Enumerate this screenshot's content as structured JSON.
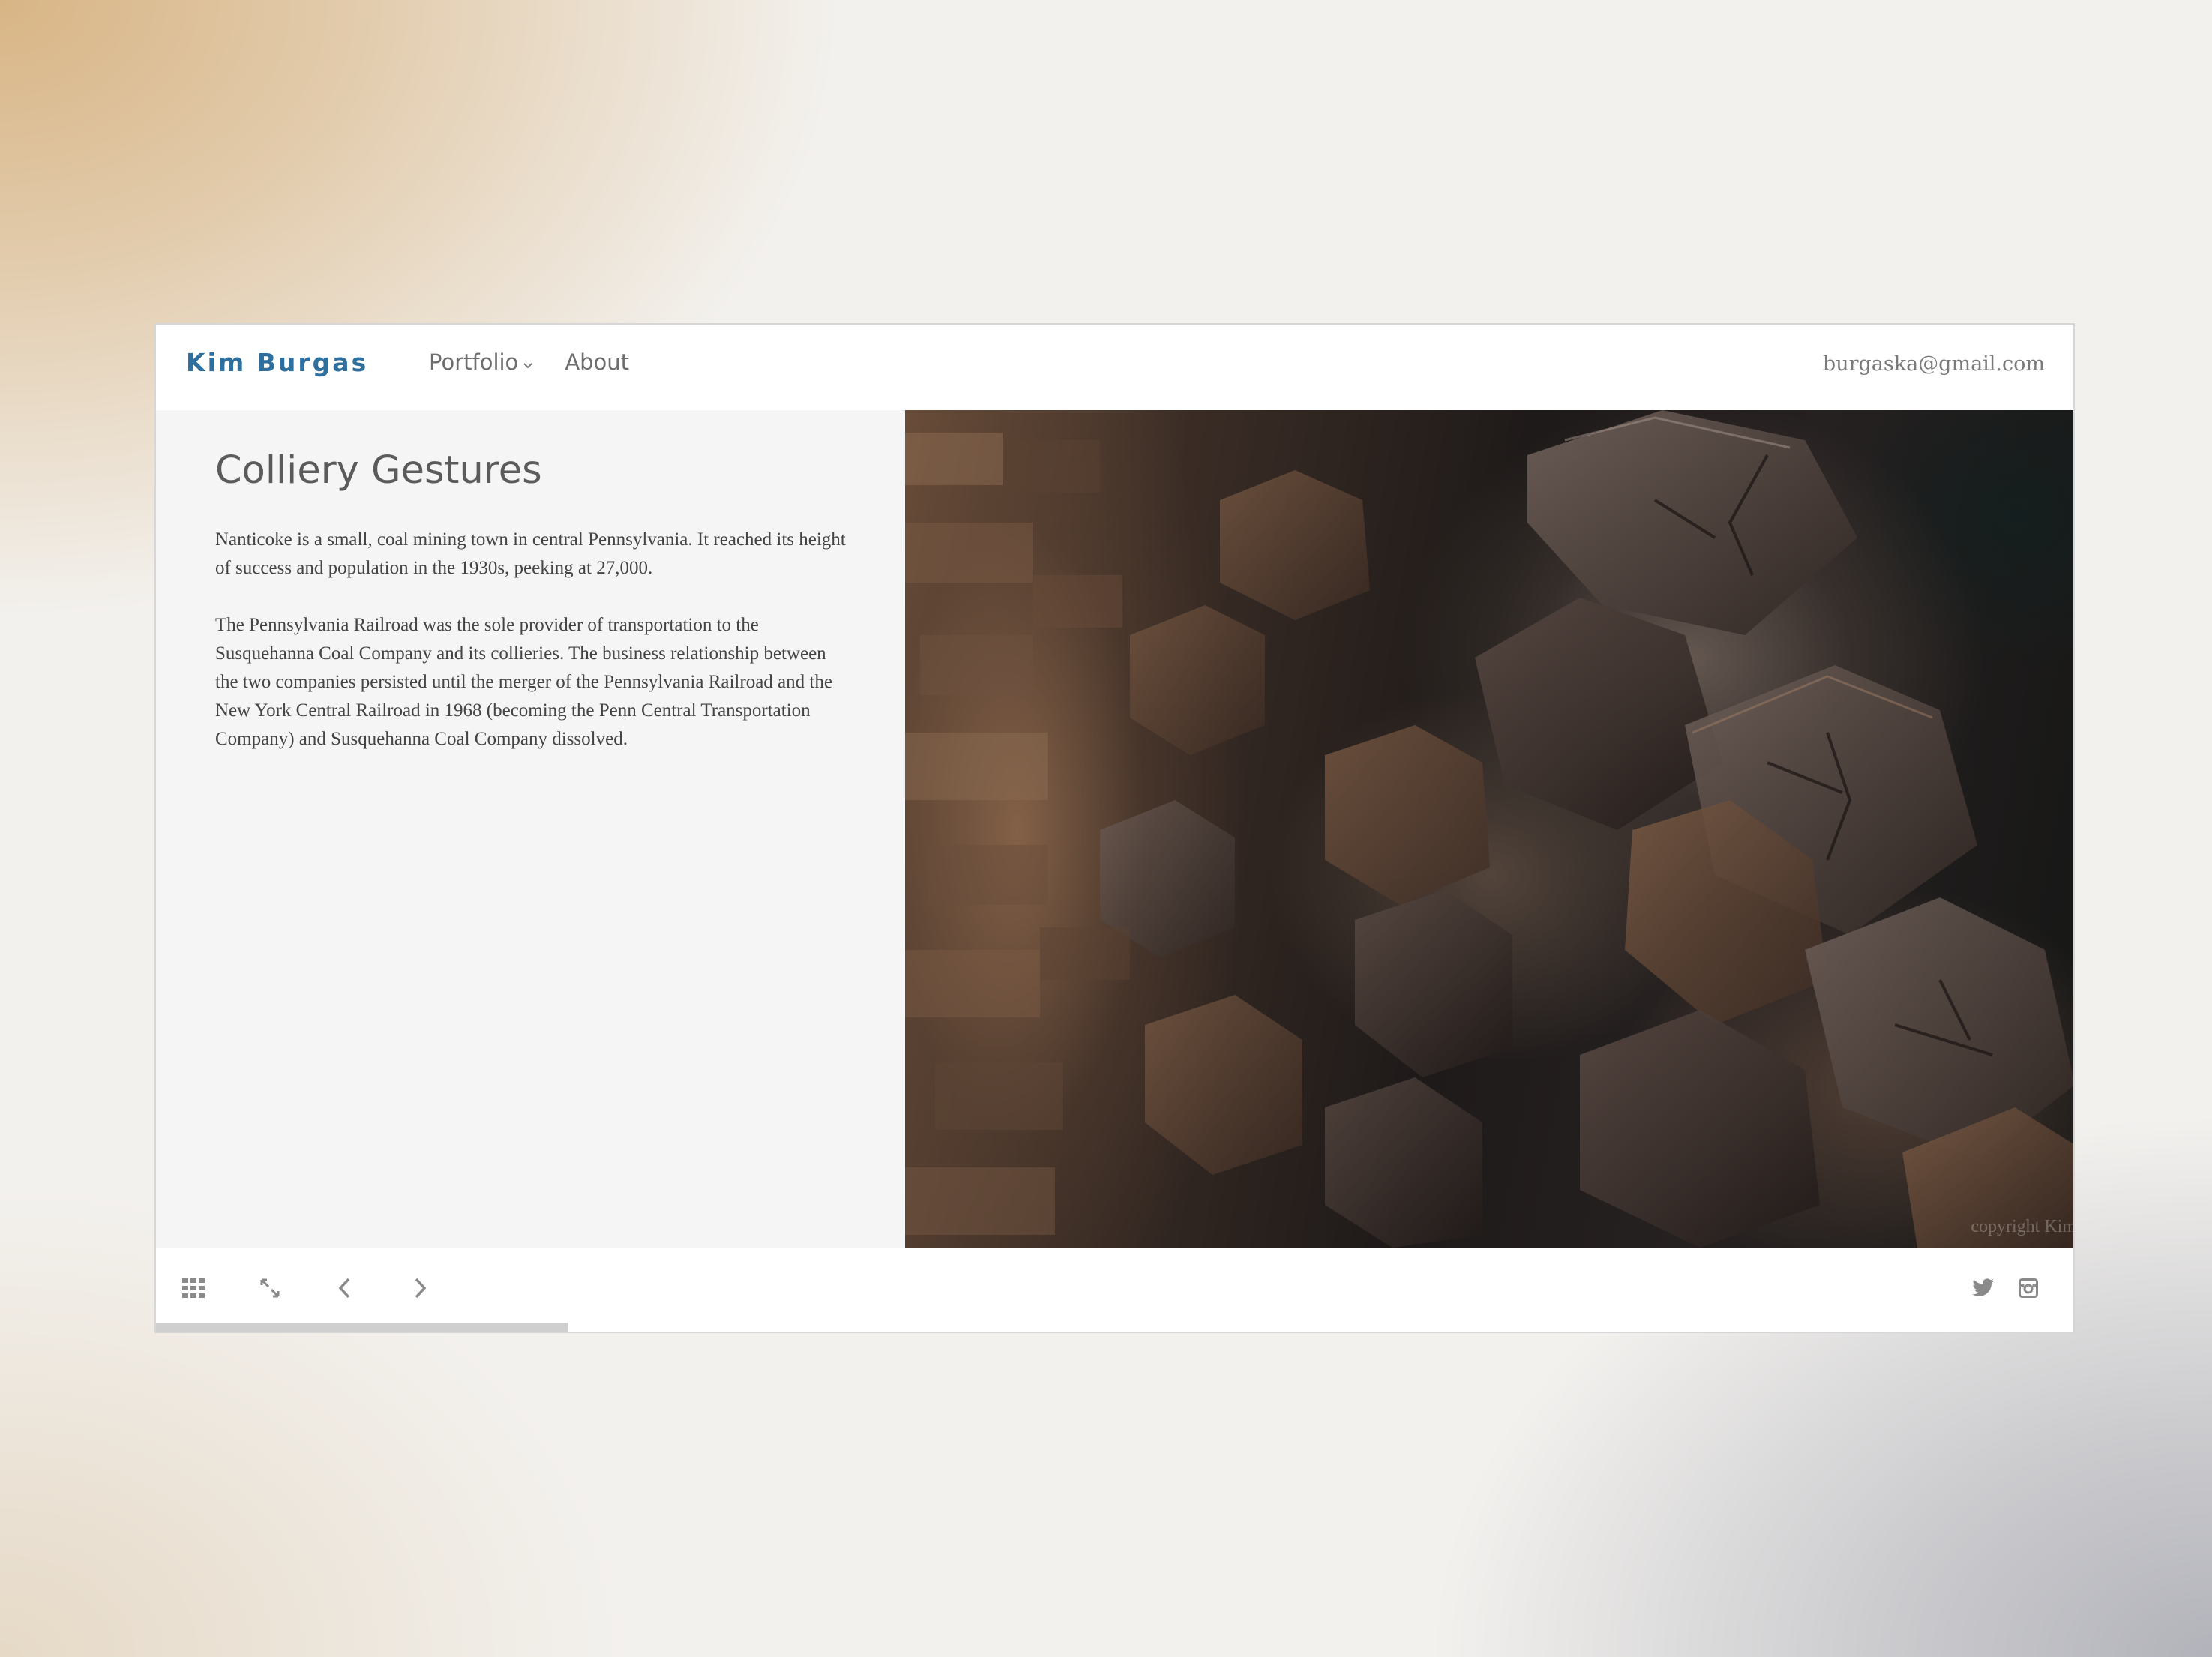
{
  "header": {
    "brand": "Kim Burgas",
    "nav": [
      {
        "label": "Portfolio",
        "has_dropdown": true,
        "icon": "chevron-down-icon"
      },
      {
        "label": "About",
        "has_dropdown": false
      }
    ],
    "email": "burgaska@gmail.com"
  },
  "content": {
    "title": "Colliery Gestures",
    "paragraphs": [
      "Nanticoke is a small, coal mining town in central Pennsylvania. It reached its height of success and population in the 1930s, peeking at 27,000.",
      "The Pennsylvania Railroad was the sole provider of transportation to the Susquehanna Coal Company and its collieries. The business relationship between the two companies persisted until the merger of the Pennsylvania Railroad and the New York Central Railroad in 1968 (becoming the Penn Central Transportation Company) and Susquehanna Coal Company dissolved."
    ]
  },
  "photo": {
    "subject": "stacked weathered wooden railroad ties",
    "watermark": "copyright Kim"
  },
  "footer": {
    "controls": [
      {
        "name": "grid-icon"
      },
      {
        "name": "fullscreen-icon"
      },
      {
        "name": "chevron-left-icon"
      },
      {
        "name": "chevron-right-icon"
      }
    ],
    "social": [
      {
        "name": "twitter-icon"
      },
      {
        "name": "instagram-icon"
      }
    ],
    "progress_fraction": 0.215
  },
  "colors": {
    "brand": "#2f6f9e",
    "panel_bg": "#f5f5f5",
    "text": "#444444",
    "icon": "#8a8a8a"
  }
}
